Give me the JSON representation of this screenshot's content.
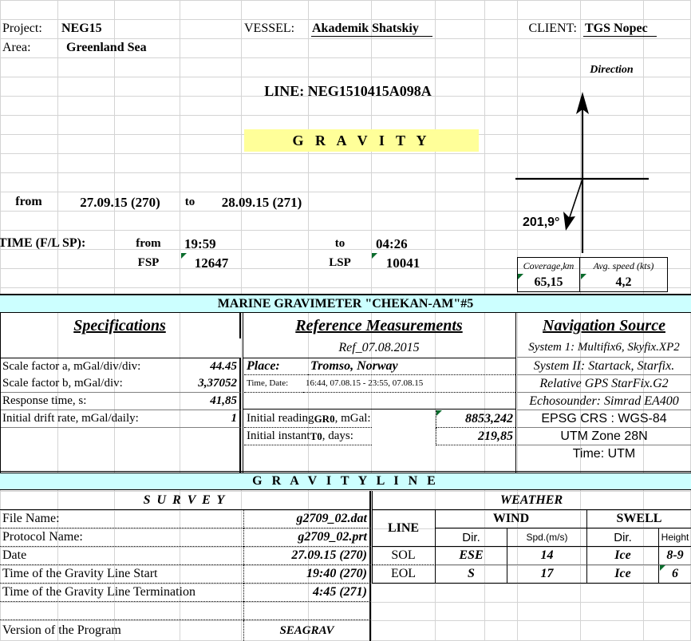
{
  "header": {
    "project_label": "Project:",
    "project_value": "NEG15",
    "area_label": "Area:",
    "area_value": "Greenland Sea",
    "vessel_label": "VESSEL:",
    "vessel_value": "Akademik Shatskiy",
    "client_label": "CLIENT:",
    "client_value": "TGS Nopec",
    "line_title": "LINE: NEG1510415A098A",
    "gravity_banner": "G R A V I T Y"
  },
  "dates": {
    "from_label": "from",
    "from_value": "27.09.15 (270)",
    "to_label": "to",
    "to_value": "28.09.15 (271)"
  },
  "times": {
    "row_label": "TIME (F/L SP):",
    "from_label": "from",
    "from_value": "19:59",
    "to_label": "to",
    "to_value": "04:26",
    "fsp_label": "FSP",
    "fsp_value": "12647",
    "lsp_label": "LSP",
    "lsp_value": "10041"
  },
  "direction": {
    "title": "Direction",
    "bearing": "201,9°",
    "coverage_label": "Coverage,km",
    "coverage_value": "65,15",
    "speed_label": "Avg. speed (kts)",
    "speed_value": "4,2"
  },
  "gravimeter": {
    "banner": "MARINE GRAVIMETER \"CHEKAN-AM\"#5",
    "specs_title": "Specifications",
    "specs": [
      {
        "label": "Scale factor a, mGal/div/div:",
        "value": "44.45"
      },
      {
        "label": "Scale factor b, mGal/div:",
        "value": "3,37052"
      },
      {
        "label": "Response time, s:",
        "value": "41,85"
      },
      {
        "label": "Initial drift rate, mGal/daily:",
        "value": "1"
      }
    ],
    "ref_title": "Reference Measurements",
    "ref_subtitle": "Ref_07.08.2015",
    "place_label": "Place:",
    "place_value": "Tromso, Norway",
    "timedate_label": "Time, Date:",
    "timedate_value": "16:44, 07.08.15 - 23:55, 07.08.15",
    "gr0_label_a": "Initial reading ",
    "gr0_label_b": "GR0",
    "gr0_label_c": ", mGal:",
    "gr0_value": "8853,242",
    "t0_label_a": "Initial instant ",
    "t0_label_b": "T0",
    "t0_label_c": ", days:",
    "t0_value": "219,85",
    "nav_title": "Navigation Source",
    "nav_lines": [
      "System 1: Multifix6, Skyfix.XP2",
      "System II: Startack, Starfix.",
      "Relative GPS StarFix.G2",
      "Echosounder: Simrad EA400"
    ],
    "nav_lines_sans": [
      "EPSG CRS : WGS-84",
      "UTM Zone 28N",
      "Time: UTM"
    ]
  },
  "gravity_line": {
    "banner": "G R A V I T Y    L I N E",
    "survey_title": "S U R V E Y",
    "rows": [
      {
        "label": "File Name:",
        "value": "g2709_02.dat"
      },
      {
        "label": "Protocol Name:",
        "value": "g2709_02.prt"
      },
      {
        "label": "Date",
        "value": "27.09.15 (270)"
      },
      {
        "label": "Time of the Gravity Line Start",
        "value": "19:40 (270)"
      },
      {
        "label": "Time of the Gravity Line Termination",
        "value": "4:45 (271)"
      },
      {
        "label": "",
        "value": ""
      },
      {
        "label": "Version of the Program",
        "value": "SEAGRAV"
      }
    ],
    "weather_title": "WEATHER",
    "line_col": "LINE",
    "wind_title": "WIND",
    "swell_title": "SWELL",
    "sub_headers": [
      "Dir.",
      "Spd.(m/s)",
      "Dir.",
      "Height"
    ],
    "weather_rows": [
      {
        "line": "SOL",
        "wind_dir": "ESE",
        "wind_spd": "14",
        "swell_dir": "Ice",
        "swell_height": "8-9"
      },
      {
        "line": "EOL",
        "wind_dir": "S",
        "wind_spd": "17",
        "swell_dir": "Ice",
        "swell_height": "6"
      }
    ]
  },
  "colors": {
    "banner_fill": "#ccffff",
    "gravity_fill": "#ffff99",
    "comment_marker": "#0a6b2c",
    "gridline": "#d4d4d4"
  }
}
